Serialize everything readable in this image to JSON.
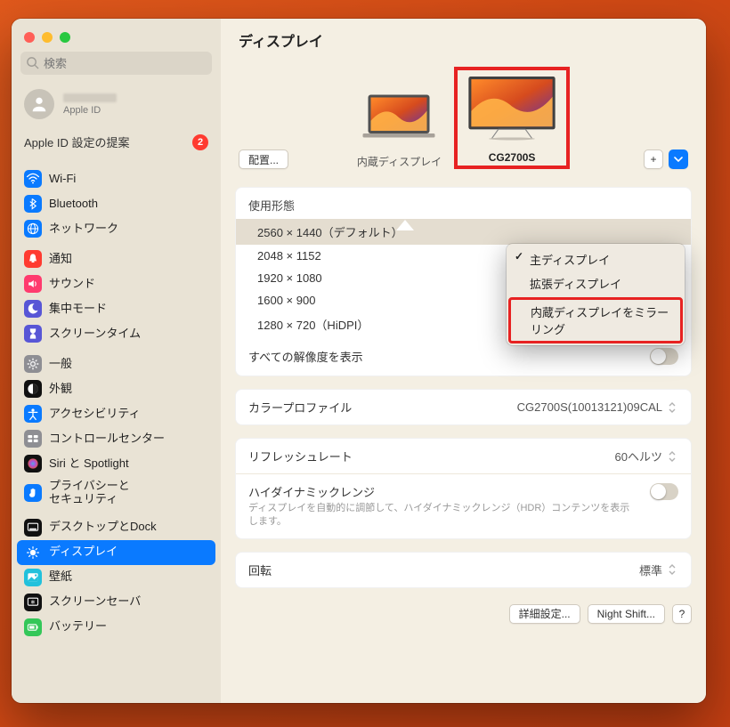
{
  "header": {
    "title": "ディスプレイ"
  },
  "search": {
    "placeholder": "検索"
  },
  "appleid": {
    "sub": "Apple ID",
    "suggestion": "Apple ID 設定の提案",
    "badge": "2"
  },
  "sidebar_groups": [
    [
      {
        "icon_bg": "#0a7aff",
        "glyph": "wifi",
        "label": "Wi-Fi"
      },
      {
        "icon_bg": "#0a7aff",
        "glyph": "bt",
        "label": "Bluetooth"
      },
      {
        "icon_bg": "#0a7aff",
        "glyph": "globe",
        "label": "ネットワーク"
      }
    ],
    [
      {
        "icon_bg": "#ff3b30",
        "glyph": "bell",
        "label": "通知"
      },
      {
        "icon_bg": "#ff3b6e",
        "glyph": "snd",
        "label": "サウンド"
      },
      {
        "icon_bg": "#5856d6",
        "glyph": "moon",
        "label": "集中モード"
      },
      {
        "icon_bg": "#5856d6",
        "glyph": "hour",
        "label": "スクリーンタイム"
      }
    ],
    [
      {
        "icon_bg": "#8e8e93",
        "glyph": "gear",
        "label": "一般"
      },
      {
        "icon_bg": "#111",
        "glyph": "appear",
        "label": "外観"
      },
      {
        "icon_bg": "#0a7aff",
        "glyph": "access",
        "label": "アクセシビリティ"
      },
      {
        "icon_bg": "#8e8e93",
        "glyph": "cc",
        "label": "コントロールセンター"
      },
      {
        "icon_bg": "#111",
        "glyph": "siri",
        "label": "Siri と Spotlight"
      },
      {
        "icon_bg": "#0a7aff",
        "glyph": "hand",
        "label": "プライバシーと\nセキュリティ"
      }
    ],
    [
      {
        "icon_bg": "#111",
        "glyph": "dock",
        "label": "デスクトップとDock"
      },
      {
        "icon_bg": "#0a7aff",
        "glyph": "disp",
        "label": "ディスプレイ",
        "active": true
      },
      {
        "icon_bg": "#22c1dc",
        "glyph": "wall",
        "label": "壁紙"
      },
      {
        "icon_bg": "#111",
        "glyph": "ss",
        "label": "スクリーンセーバ"
      },
      {
        "icon_bg": "#34c759",
        "glyph": "batt",
        "label": "バッテリー"
      }
    ]
  ],
  "displays": {
    "arrange_btn": "配置...",
    "internal": "内蔵ディスプレイ",
    "external": "CG2700S"
  },
  "usage_popup": {
    "items": [
      "主ディスプレイ",
      "拡張ディスプレイ",
      "内蔵ディスプレイをミラーリング"
    ],
    "checked_index": 0,
    "highlighted_index": 2
  },
  "settings": {
    "usage_label": "使用形態",
    "resolutions": [
      "2560 × 1440（デフォルト）",
      "2048 × 1152",
      "1920 × 1080",
      "1600 × 900",
      "1280 × 720（HiDPI）"
    ],
    "selected_res_index": 0,
    "show_all": "すべての解像度を表示",
    "color_profile_label": "カラープロファイル",
    "color_profile_value": "CG2700S(10013121)09CAL",
    "refresh_label": "リフレッシュレート",
    "refresh_value": "60ヘルツ",
    "hdr_label": "ハイダイナミックレンジ",
    "hdr_sub": "ディスプレイを自動的に調節して、ハイダイナミックレンジ（HDR）コンテンツを表示します。",
    "rotation_label": "回転",
    "rotation_value": "標準",
    "advanced_btn": "詳細設定...",
    "nightshift_btn": "Night Shift...",
    "help_btn": "?"
  }
}
